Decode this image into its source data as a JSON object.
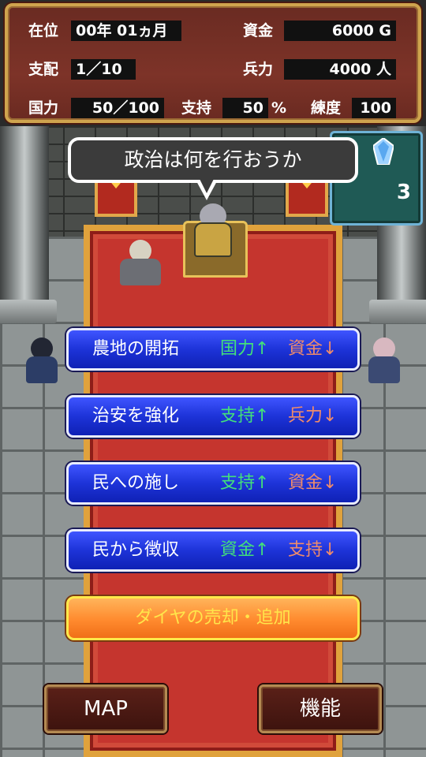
{
  "status": {
    "reign_label": "在位",
    "reign_value": "00年 01ヵ月",
    "funds_label": "資金",
    "funds_value": "6000 G",
    "control_label": "支配",
    "control_value": "1／10",
    "troops_label": "兵力",
    "troops_value": "4000 人",
    "power_label": "国力",
    "power_value": "50／100",
    "support_label": "支持",
    "support_value": "50",
    "support_unit": "%",
    "skill_label": "練度",
    "skill_value": "100"
  },
  "gems": {
    "count": "3",
    "icon": "crystal-gem-icon"
  },
  "dialog": {
    "text": "政治は何を行おうか"
  },
  "actions": [
    {
      "label": "農地の開拓",
      "up": "国力↑",
      "down": "資金↓"
    },
    {
      "label": "治安を強化",
      "up": "支持↑",
      "down": "兵力↓"
    },
    {
      "label": "民への施し",
      "up": "支持↑",
      "down": "資金↓"
    },
    {
      "label": "民から徴収",
      "up": "資金↑",
      "down": "支持↓"
    }
  ],
  "diamond_button": "ダイヤの売却・追加",
  "nav": {
    "map": "MAP",
    "functions": "機能"
  },
  "colors": {
    "action_blue": "#1d33d8",
    "increase_green": "#43e07a",
    "decrease_orange": "#f08c6a",
    "diamond_orange": "#ff8a2e",
    "panel_maroon": "#7d3328"
  }
}
